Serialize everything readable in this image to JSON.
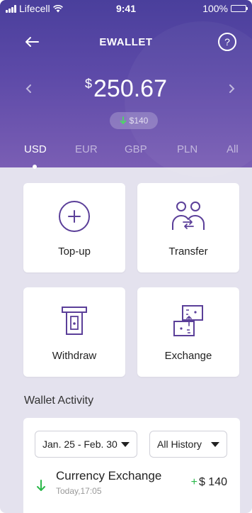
{
  "status_bar": {
    "carrier": "Lifecell",
    "time": "9:41",
    "battery": "100%",
    "battery_level": 1.0
  },
  "nav": {
    "title": "EWALLET",
    "help_label": "?"
  },
  "balance": {
    "currency_symbol": "$",
    "amount": "250.67",
    "change": "$140"
  },
  "currency_tabs": [
    {
      "label": "USD",
      "active": true
    },
    {
      "label": "EUR",
      "active": false
    },
    {
      "label": "GBP",
      "active": false
    },
    {
      "label": "PLN",
      "active": false
    },
    {
      "label": "All",
      "active": false
    }
  ],
  "actions": [
    {
      "label": "Top-up",
      "icon": "plus-circle-icon"
    },
    {
      "label": "Transfer",
      "icon": "transfer-users-icon"
    },
    {
      "label": "Withdraw",
      "icon": "atm-withdraw-icon"
    },
    {
      "label": "Exchange",
      "icon": "exchange-icon"
    }
  ],
  "activity": {
    "section_title": "Wallet Activity",
    "date_filter": "Jan. 25 - Feb. 30",
    "history_filter": "All History",
    "items": [
      {
        "title": "Currency Exchange",
        "time": "Today,17:05",
        "sign": "+",
        "amount": "$ 140"
      }
    ]
  },
  "colors": {
    "accent": "#5b3f99",
    "positive": "#2ab84a",
    "hero_top": "#4a3f9c",
    "hero_bottom": "#7a5eb4"
  }
}
